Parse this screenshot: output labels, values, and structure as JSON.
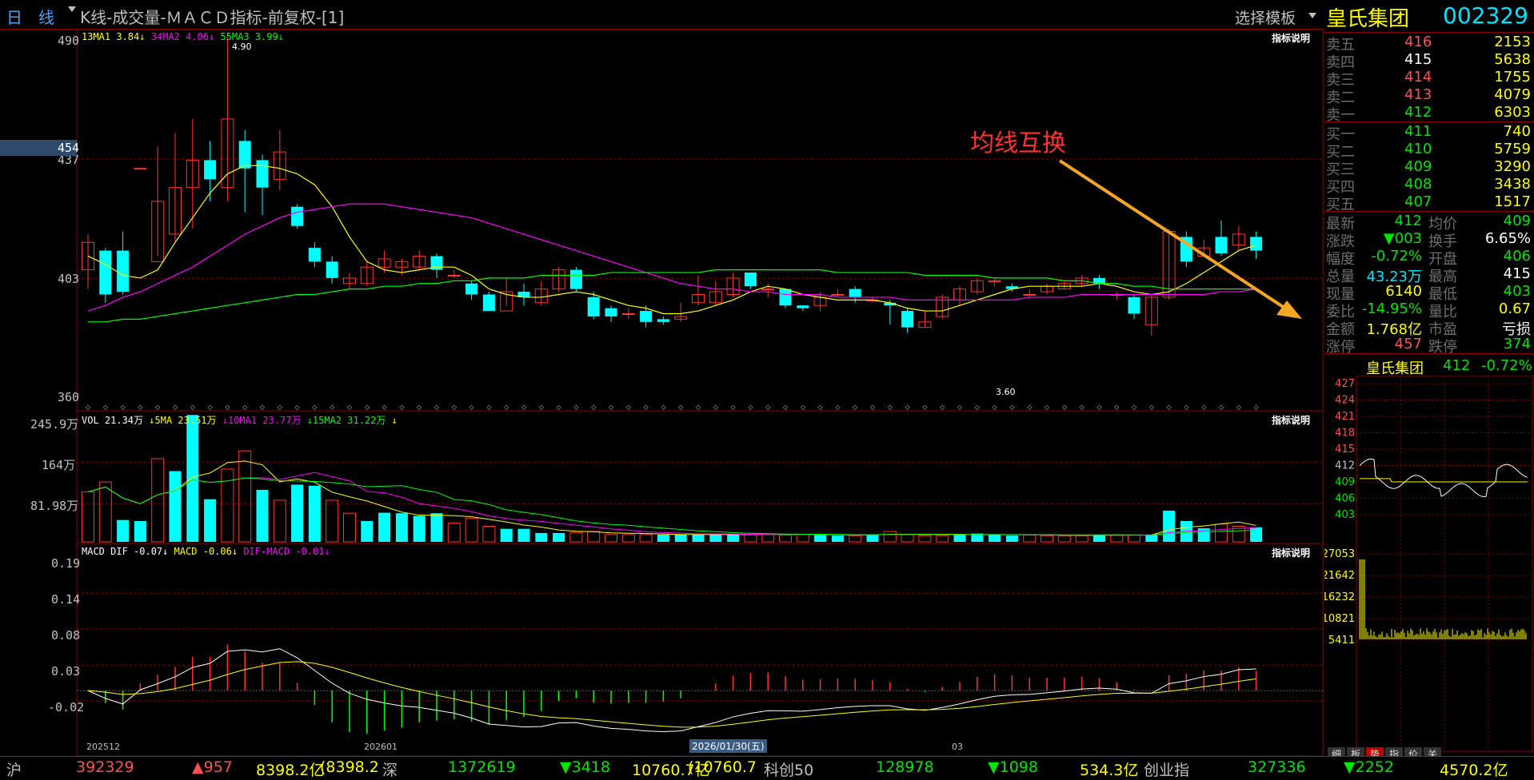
{
  "header": {
    "period": "日　线",
    "title": "K线-成交量-ＭＡＣＤ指标-前复权-[1]",
    "template_btn": "选择模板",
    "stock_name": "皇氏集团",
    "stock_code": "002329"
  },
  "colors": {
    "up": "#ff3232",
    "down": "#00ffff",
    "ma_yellow": "#ffff00",
    "ma_magenta": "#ff00ff",
    "ma_green": "#00ff00",
    "grid": "#8b0000",
    "annotation": "#ff3030",
    "arrow": "#f5a623"
  },
  "main_chart": {
    "indicator_line": [
      {
        "text": "13MA1 3.84↓",
        "color": "#ffff00"
      },
      {
        "text": "34MA2 4.06↓",
        "color": "#ff00ff"
      },
      {
        "text": "55MA3 3.99↓",
        "color": "#00ff00"
      }
    ],
    "help": "指标说明",
    "y_labels": [
      "490",
      "437",
      "403",
      "360"
    ],
    "price_marker": "454",
    "high_label": "4.90",
    "low_label": "3.60",
    "annotation": "均线互换"
  },
  "vol_chart": {
    "indicator_line": [
      {
        "text": "VOL 21.34万",
        "color": "#ffffff"
      },
      {
        "text": "↓5MA 23.51万",
        "color": "#ffff00"
      },
      {
        "text": "↓10MA1 23.77万",
        "color": "#ff00ff"
      },
      {
        "text": "↓15MA2 31.22万",
        "color": "#00ff00"
      },
      {
        "text": "↓",
        "color": "#ffff00"
      }
    ],
    "help": "指标说明",
    "y_labels": [
      "245.9万",
      "164万",
      "81.98万"
    ]
  },
  "macd_chart": {
    "indicator_line": [
      {
        "text": "MACD DIF -0.07↓",
        "color": "#ffffff"
      },
      {
        "text": "MACD -0.06↓",
        "color": "#ffff00"
      },
      {
        "text": "DIF-MACD -0.01↓",
        "color": "#ff00ff"
      }
    ],
    "help": "指标说明",
    "y_labels": [
      "0.19",
      "0.14",
      "0.08",
      "0.03",
      "-0.02"
    ],
    "x_labels": [
      "202512",
      "202601",
      "03"
    ],
    "date_tag": "2026/01/30(五)"
  },
  "chart_data": {
    "type": "candlestick",
    "price_range": [
      3.6,
      4.9
    ],
    "candles": [
      [
        4.05,
        4.15,
        4.18,
        3.98
      ],
      [
        4.12,
        3.96,
        4.13,
        3.93
      ],
      [
        4.12,
        3.97,
        4.19,
        3.96
      ],
      [
        4.42,
        4.42,
        4.42,
        4.42
      ],
      [
        4.08,
        4.3,
        4.5,
        4.1
      ],
      [
        4.18,
        4.35,
        4.55,
        4.15
      ],
      [
        4.35,
        4.45,
        4.6,
        4.2
      ],
      [
        4.45,
        4.38,
        4.52,
        4.3
      ],
      [
        4.35,
        4.6,
        4.9,
        4.3
      ],
      [
        4.52,
        4.42,
        4.56,
        4.26
      ],
      [
        4.45,
        4.35,
        4.47,
        4.25
      ],
      [
        4.38,
        4.48,
        4.56,
        4.34
      ],
      [
        4.28,
        4.21,
        4.29,
        4.2
      ],
      [
        4.13,
        4.08,
        4.15,
        4.06
      ],
      [
        4.08,
        4.02,
        4.1,
        4.0
      ],
      [
        4.0,
        4.02,
        4.04,
        3.98
      ],
      [
        4.0,
        4.06,
        4.08,
        3.99
      ],
      [
        4.06,
        4.09,
        4.12,
        4.04
      ],
      [
        4.06,
        4.08,
        4.09,
        4.03
      ],
      [
        4.06,
        4.1,
        4.12,
        4.05
      ],
      [
        4.1,
        4.05,
        4.11,
        4.02
      ],
      [
        4.03,
        4.03,
        4.05,
        4.02
      ],
      [
        4.0,
        3.96,
        4.01,
        3.94
      ],
      [
        3.96,
        3.9,
        3.97,
        3.9
      ],
      [
        3.9,
        3.97,
        4.02,
        3.92
      ],
      [
        3.97,
        3.95,
        4.0,
        3.92
      ],
      [
        3.93,
        3.98,
        4.01,
        3.92
      ],
      [
        3.98,
        4.05,
        4.06,
        3.97
      ],
      [
        4.05,
        3.98,
        4.06,
        3.97
      ],
      [
        3.95,
        3.88,
        3.97,
        3.87
      ],
      [
        3.91,
        3.88,
        3.92,
        3.86
      ],
      [
        3.89,
        3.89,
        3.91,
        3.87
      ],
      [
        3.9,
        3.86,
        3.92,
        3.84
      ],
      [
        3.87,
        3.86,
        3.88,
        3.85
      ],
      [
        3.87,
        3.88,
        3.93,
        3.86
      ],
      [
        3.93,
        3.96,
        4.03,
        3.92
      ],
      [
        3.93,
        3.97,
        4.01,
        3.92
      ],
      [
        3.96,
        4.02,
        4.04,
        3.95
      ],
      [
        4.04,
        3.99,
        4.04,
        3.98
      ],
      [
        3.98,
        3.98,
        4.0,
        3.95
      ],
      [
        3.98,
        3.92,
        3.98,
        3.91
      ],
      [
        3.92,
        3.91,
        3.92,
        3.9
      ],
      [
        3.92,
        3.95,
        3.97,
        3.9
      ],
      [
        3.96,
        3.96,
        3.98,
        3.95
      ],
      [
        3.98,
        3.95,
        3.99,
        3.93
      ],
      [
        3.94,
        3.94,
        3.95,
        3.93
      ],
      [
        3.93,
        3.92,
        3.94,
        3.85
      ],
      [
        3.9,
        3.84,
        3.91,
        3.82
      ],
      [
        3.84,
        3.86,
        3.9,
        3.84
      ],
      [
        3.88,
        3.95,
        3.96,
        3.87
      ],
      [
        3.94,
        3.98,
        3.99,
        3.92
      ],
      [
        3.97,
        4.01,
        4.02,
        3.96
      ],
      [
        4.01,
        4.01,
        4.02,
        3.99
      ],
      [
        3.99,
        3.98,
        4.0,
        3.97
      ],
      [
        3.96,
        3.96,
        3.98,
        3.95
      ],
      [
        3.97,
        3.99,
        4.0,
        3.96
      ],
      [
        3.98,
        4.0,
        4.01,
        3.98
      ],
      [
        4.0,
        4.02,
        4.03,
        3.99
      ],
      [
        4.02,
        4.0,
        4.03,
        3.98
      ],
      [
        3.96,
        3.96,
        3.97,
        3.94
      ],
      [
        3.95,
        3.89,
        3.96,
        3.87
      ],
      [
        3.85,
        3.95,
        3.96,
        3.81
      ],
      [
        3.95,
        4.19,
        4.2,
        3.94
      ],
      [
        4.17,
        4.08,
        4.19,
        4.06
      ],
      [
        4.1,
        4.13,
        4.16,
        4.1
      ],
      [
        4.17,
        4.11,
        4.23,
        4.1
      ],
      [
        4.14,
        4.18,
        4.21,
        4.12
      ],
      [
        4.17,
        4.12,
        4.19,
        4.09
      ]
    ],
    "volume": [
      [
        96,
        0
      ],
      [
        115,
        0
      ],
      [
        42,
        1
      ],
      [
        40,
        1
      ],
      [
        160,
        0
      ],
      [
        136,
        1
      ],
      [
        244,
        1
      ],
      [
        82,
        1
      ],
      [
        140,
        0
      ],
      [
        175,
        0
      ],
      [
        100,
        1
      ],
      [
        80,
        0
      ],
      [
        110,
        1
      ],
      [
        108,
        1
      ],
      [
        80,
        0
      ],
      [
        55,
        0
      ],
      [
        40,
        1
      ],
      [
        56,
        1
      ],
      [
        55,
        1
      ],
      [
        50,
        1
      ],
      [
        55,
        1
      ],
      [
        36,
        0
      ],
      [
        45,
        0
      ],
      [
        30,
        0
      ],
      [
        25,
        1
      ],
      [
        25,
        1
      ],
      [
        17,
        1
      ],
      [
        17,
        1
      ],
      [
        18,
        0
      ],
      [
        20,
        0
      ],
      [
        14,
        0
      ],
      [
        14,
        0
      ],
      [
        14,
        0
      ],
      [
        14,
        1
      ],
      [
        14,
        1
      ],
      [
        14,
        1
      ],
      [
        14,
        1
      ],
      [
        14,
        1
      ],
      [
        14,
        0
      ],
      [
        14,
        0
      ],
      [
        13,
        0
      ],
      [
        14,
        0
      ],
      [
        14,
        1
      ],
      [
        12,
        1
      ],
      [
        12,
        0
      ],
      [
        14,
        1
      ],
      [
        20,
        0
      ],
      [
        14,
        0
      ],
      [
        12,
        0
      ],
      [
        12,
        0
      ],
      [
        14,
        1
      ],
      [
        16,
        1
      ],
      [
        14,
        1
      ],
      [
        12,
        1
      ],
      [
        13,
        0
      ],
      [
        12,
        0
      ],
      [
        12,
        0
      ],
      [
        12,
        0
      ],
      [
        14,
        1
      ],
      [
        13,
        0
      ],
      [
        13,
        0
      ],
      [
        14,
        1
      ],
      [
        60,
        1
      ],
      [
        40,
        1
      ],
      [
        26,
        1
      ],
      [
        34,
        0
      ],
      [
        30,
        0
      ],
      [
        28,
        1
      ]
    ],
    "ma5": [
      4.1,
      4.07,
      4.03,
      4.02,
      4.05,
      4.15,
      4.24,
      4.33,
      4.4,
      4.43,
      4.43,
      4.42,
      4.4,
      4.36,
      4.28,
      4.17,
      4.08,
      4.05,
      4.04,
      4.05,
      4.06,
      4.06,
      4.03,
      3.98,
      3.96,
      3.95,
      3.95,
      3.96,
      3.97,
      3.96,
      3.94,
      3.92,
      3.91,
      3.89,
      3.89,
      3.9,
      3.92,
      3.94,
      3.97,
      3.99,
      3.98,
      3.96,
      3.95,
      3.94,
      3.94,
      3.94,
      3.93,
      3.91,
      3.9,
      3.9,
      3.92,
      3.94,
      3.96,
      3.98,
      3.99,
      3.99,
      3.99,
      3.99,
      4.0,
      3.99,
      3.97,
      3.96,
      3.97,
      4.0,
      4.04,
      4.08,
      4.12,
      4.14
    ],
    "ma10": [
      3.9,
      3.92,
      3.95,
      3.97,
      4.0,
      4.03,
      4.06,
      4.1,
      4.14,
      4.18,
      4.21,
      4.24,
      4.26,
      4.27,
      4.28,
      4.29,
      4.29,
      4.29,
      4.28,
      4.27,
      4.26,
      4.25,
      4.24,
      4.22,
      4.2,
      4.18,
      4.16,
      4.14,
      4.12,
      4.1,
      4.08,
      4.06,
      4.04,
      4.02,
      4.0,
      3.99,
      3.98,
      3.98,
      3.97,
      3.97,
      3.96,
      3.96,
      3.96,
      3.95,
      3.95,
      3.95,
      3.95,
      3.94,
      3.94,
      3.94,
      3.94,
      3.94,
      3.94,
      3.94,
      3.95,
      3.95,
      3.95,
      3.96,
      3.96,
      3.96,
      3.96,
      3.96,
      3.96,
      3.96,
      3.96,
      3.97,
      3.97,
      3.98
    ],
    "ma55": [
      3.86,
      3.86,
      3.87,
      3.87,
      3.88,
      3.89,
      3.9,
      3.91,
      3.92,
      3.93,
      3.94,
      3.95,
      3.96,
      3.96,
      3.97,
      3.98,
      3.98,
      3.99,
      3.99,
      4.0,
      4.0,
      4.01,
      4.01,
      4.02,
      4.02,
      4.02,
      4.03,
      4.03,
      4.03,
      4.03,
      4.04,
      4.04,
      4.04,
      4.04,
      4.04,
      4.04,
      4.05,
      4.05,
      4.05,
      4.05,
      4.05,
      4.05,
      4.05,
      4.04,
      4.04,
      4.04,
      4.04,
      4.04,
      4.03,
      4.03,
      4.03,
      4.03,
      4.02,
      4.02,
      4.02,
      4.02,
      4.01,
      4.01,
      4.0,
      4.0,
      3.99,
      3.99,
      3.98,
      3.98,
      3.98,
      3.98,
      3.98,
      3.98
    ]
  },
  "quote": {
    "sells": [
      {
        "label": "卖五",
        "price": "416",
        "vol": "2153"
      },
      {
        "label": "卖四",
        "price": "415",
        "vol": "5638"
      },
      {
        "label": "卖三",
        "price": "414",
        "vol": "1755"
      },
      {
        "label": "卖二",
        "price": "413",
        "vol": "4079"
      },
      {
        "label": "卖一",
        "price": "412",
        "vol": "6303"
      }
    ],
    "buys": [
      {
        "label": "买一",
        "price": "411",
        "vol": "740"
      },
      {
        "label": "买二",
        "price": "410",
        "vol": "5759"
      },
      {
        "label": "买三",
        "price": "409",
        "vol": "3290"
      },
      {
        "label": "买四",
        "price": "408",
        "vol": "3438"
      },
      {
        "label": "买五",
        "price": "407",
        "vol": "1517"
      }
    ],
    "stats": [
      {
        "l1": "最新",
        "v1": "412",
        "c1": "#00e600",
        "l2": "均价",
        "v2": "409",
        "c2": "#00e600"
      },
      {
        "l1": "涨跌",
        "v1": "▼003",
        "c1": "#00e600",
        "l2": "换手",
        "v2": "6.65%",
        "c2": "#ffffff"
      },
      {
        "l1": "幅度",
        "v1": "-0.72%",
        "c1": "#00e600",
        "l2": "开盘",
        "v2": "406",
        "c2": "#00e600"
      },
      {
        "l1": "总量",
        "v1": "43.23万",
        "c1": "#00e5ff",
        "l2": "最高",
        "v2": "415",
        "c2": "#ffffff"
      },
      {
        "l1": "现量",
        "v1": "6140",
        "c1": "#ffff00",
        "l2": "最低",
        "v2": "403",
        "c2": "#00e600"
      },
      {
        "l1": "委比",
        "v1": "-14.95%",
        "c1": "#00e600",
        "l2": "量比",
        "v2": "0.67",
        "c2": "#ffff00"
      },
      {
        "l1": "金额",
        "v1": "1.768亿",
        "c1": "#ffff00",
        "l2": "市盈",
        "v2": "亏损",
        "c2": "#ffffff"
      },
      {
        "l1": "涨停",
        "v1": "457",
        "c1": "#ff5050",
        "l2": "跌停",
        "v2": "374",
        "c2": "#00e600"
      }
    ],
    "mini_title": {
      "name": "皇氏集团",
      "price": "412",
      "pct": "-0.72%"
    },
    "mini_y": [
      "427",
      "424",
      "421",
      "418",
      "415",
      "412",
      "409",
      "406",
      "403"
    ],
    "mini_vol_y": [
      "27053",
      "21642",
      "16232",
      "10821",
      "5411"
    ],
    "tabs": [
      "细",
      "板",
      "势",
      "指",
      "价",
      "关"
    ]
  },
  "ticker": [
    {
      "text": "沪",
      "color": "#c0c0c0"
    },
    {
      "text": "392329",
      "color": "#ff5050"
    },
    {
      "text": "▲957",
      "color": "#ff5050"
    },
    {
      "text": "8398.2亿",
      "color": "#ffff00"
    },
    {
      "text": "(8398.2",
      "color": "#ffff00"
    },
    {
      "text": "深",
      "color": "#c0c0c0"
    },
    {
      "text": "1372619",
      "color": "#00e600"
    },
    {
      "text": "▼3418",
      "color": "#00e600"
    },
    {
      "text": "10760.7亿",
      "color": "#ffff00"
    },
    {
      "text": "(10760.7",
      "color": "#ffff00"
    },
    {
      "text": "科创50",
      "color": "#c0c0c0"
    },
    {
      "text": "128978",
      "color": "#00e600"
    },
    {
      "text": "▼1098",
      "color": "#00e600"
    },
    {
      "text": "534.3亿",
      "color": "#ffff00"
    },
    {
      "text": "创业指",
      "color": "#c0c0c0"
    },
    {
      "text": "327336",
      "color": "#00e600"
    },
    {
      "text": "▼2252",
      "color": "#00e600"
    },
    {
      "text": "4570.2亿",
      "color": "#ffff00"
    }
  ]
}
